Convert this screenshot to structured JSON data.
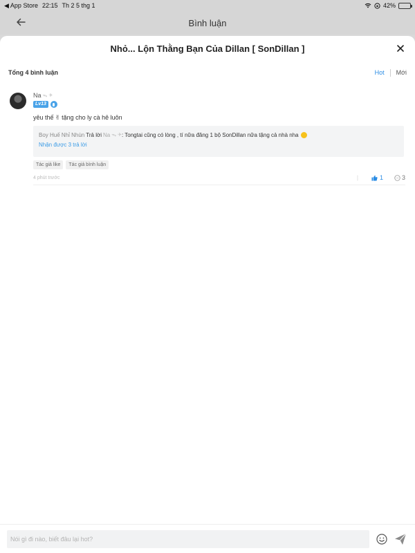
{
  "status_bar": {
    "back_app": "◀ App Store",
    "time": "22:15",
    "date": "Th 2 5 thg 1",
    "battery": "42%",
    "battery_level": 0.42
  },
  "nav": {
    "title": "Bình luận"
  },
  "sheet": {
    "title": "Nhỏ... Lộn Thằng Bạn Của Dillan [ SonDillan ]"
  },
  "summary": {
    "total": "Tổng 4 bình luận",
    "sort_hot": "Hot",
    "sort_new": "Mới"
  },
  "comment": {
    "username": "Na",
    "level": "Lv13",
    "text_before": "yêu thế",
    "text_emoji": "✌",
    "text_after": " tặng cho ly cà hê luôn",
    "reply": {
      "author": "Boy Huế Nhỉ Nhùn",
      "verb": "Trả lời",
      "target": "Na",
      "text": ": Tongtai cũng có lòng , tí nữa đăng 1 bộ SonDillan nữa tặng cả nhà nha"
    },
    "more_replies": "Nhận được 3 trả lời",
    "tags": [
      "Tác giả like",
      "Tác giả bình luận"
    ],
    "time": "4 phút trước",
    "more": "⋮",
    "likes": "1",
    "comments": "3"
  },
  "input": {
    "placeholder": "Nói gì đi nào, biết đâu lại hot?"
  }
}
